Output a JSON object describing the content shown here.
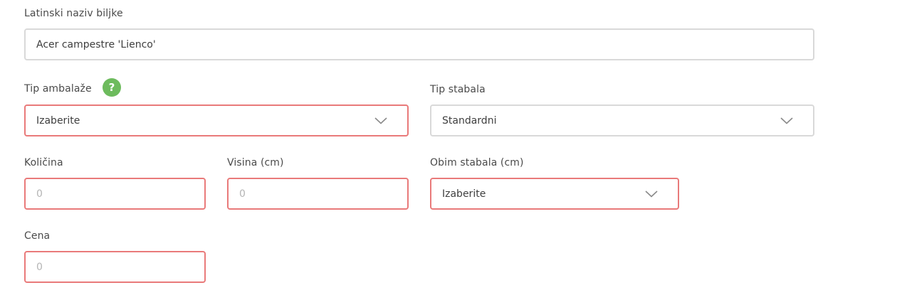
{
  "latin_name": {
    "label": "Latinski naziv biljke",
    "value": "Acer campestre 'Lienco'"
  },
  "package_type": {
    "label": "Tip ambalaže",
    "help_icon": "?",
    "selected": "Izaberite",
    "icon": "chevron-down-icon"
  },
  "tree_type": {
    "label": "Tip stabala",
    "selected": "Standardni",
    "icon": "chevron-down-icon"
  },
  "quantity": {
    "label": "Količina",
    "placeholder": "0"
  },
  "height": {
    "label": "Visina (cm)",
    "placeholder": "0"
  },
  "girth": {
    "label": "Obim stabala (cm)",
    "selected": "Izaberite",
    "icon": "chevron-down-icon"
  },
  "price": {
    "label": "Cena",
    "placeholder": "0"
  },
  "colors": {
    "error_border": "#e97a7a",
    "normal_border": "#d9d9d9",
    "help_badge": "#6dbb5d"
  }
}
